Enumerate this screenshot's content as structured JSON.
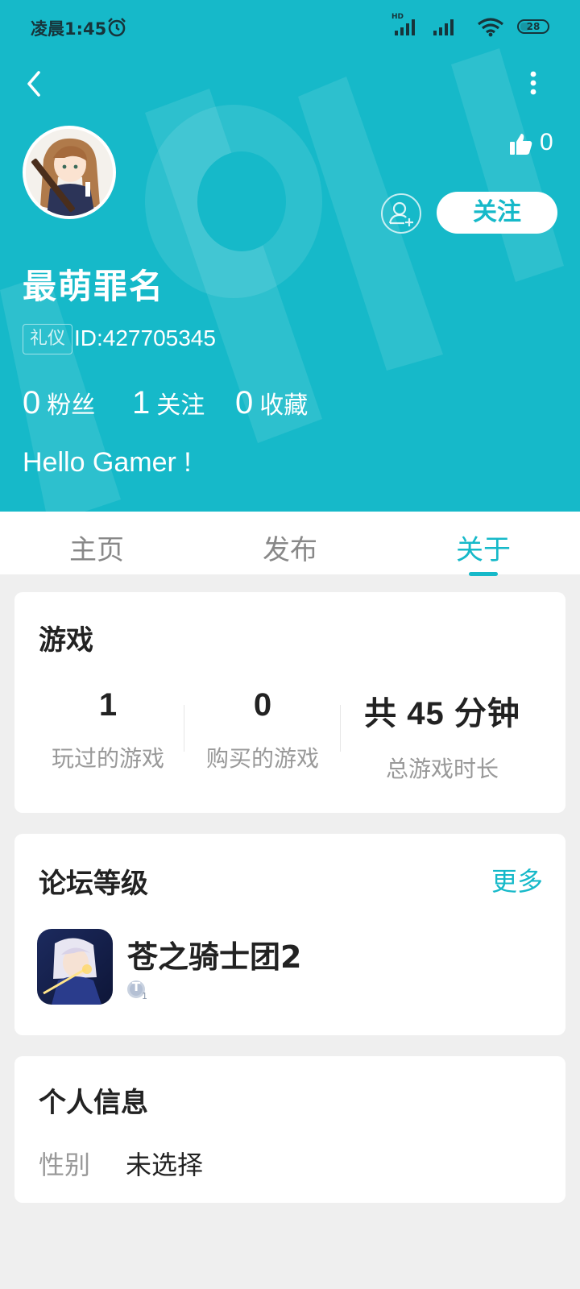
{
  "status_bar": {
    "time": "凌晨1:45",
    "network_label": "HD",
    "battery": "28"
  },
  "profile": {
    "likes": "0",
    "follow_label": "关注",
    "nickname": "最萌罪名",
    "badge": "礼仪",
    "user_id": "ID:427705345",
    "stats": {
      "fans_count": "0",
      "fans_label": "粉丝",
      "following_count": "1",
      "following_label": "关注",
      "favorites_count": "0",
      "favorites_label": "收藏"
    },
    "bio": "Hello Gamer !"
  },
  "tabs": [
    {
      "label": "主页"
    },
    {
      "label": "发布"
    },
    {
      "label": "关于"
    }
  ],
  "active_tab": "关于",
  "games_card": {
    "title": "游戏",
    "played_value": "1",
    "played_label": "玩过的游戏",
    "bought_value": "0",
    "bought_label": "购买的游戏",
    "playtime_value": "共 45 分钟",
    "playtime_label": "总游戏时长"
  },
  "forum_card": {
    "title": "论坛等级",
    "more_label": "更多",
    "game_name": "苍之骑士团2",
    "level_letter": "T",
    "level_number": "1"
  },
  "info_card": {
    "title": "个人信息",
    "gender_label": "性别",
    "gender_value": "未选择"
  },
  "colors": {
    "accent": "#16b9c9",
    "background": "#efefef",
    "card": "#ffffff",
    "text_primary": "#222222",
    "text_secondary": "#999999"
  },
  "icons": [
    "alarm-icon",
    "signal-icon",
    "wifi-icon",
    "battery-icon",
    "back-icon",
    "more-vertical-icon",
    "thumbs-up-icon",
    "add-friend-icon",
    "level-badge-icon"
  ]
}
